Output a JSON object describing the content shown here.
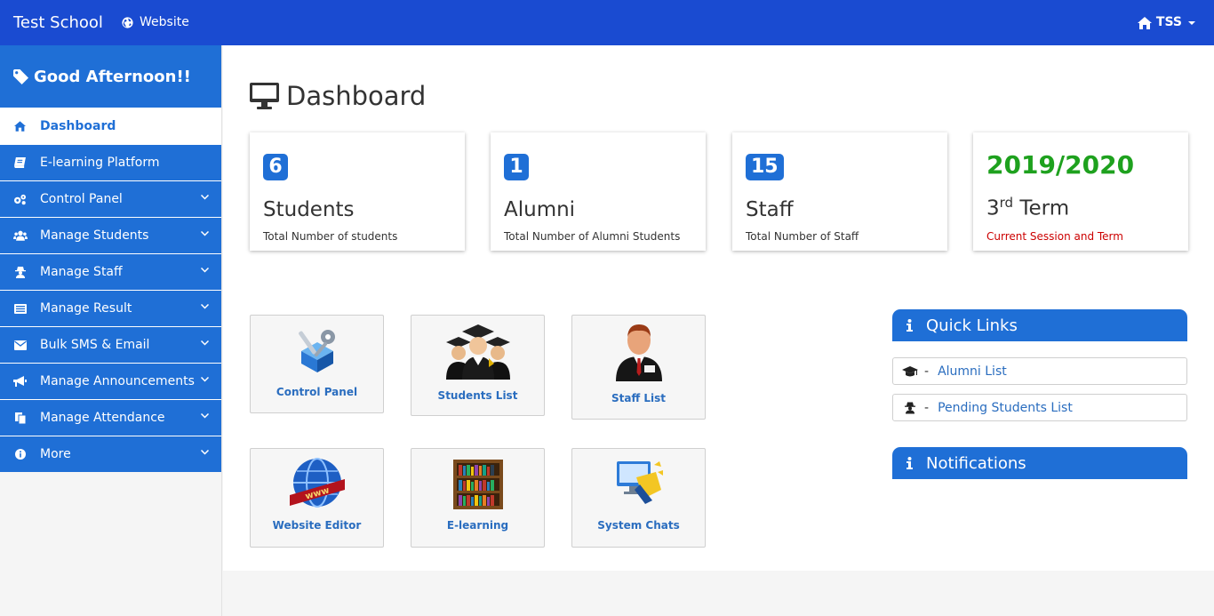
{
  "navbar": {
    "brand": "Test School",
    "website_label": "Website",
    "user_label": "TSS"
  },
  "sidebar": {
    "greeting": "Good Afternoon!!",
    "items": [
      {
        "label": "Dashboard",
        "icon": "home-icon",
        "active": true
      },
      {
        "label": "E-learning Platform",
        "icon": "book-icon"
      },
      {
        "label": "Control Panel",
        "icon": "cogs-icon"
      },
      {
        "label": "Manage Students",
        "icon": "users-icon"
      },
      {
        "label": "Manage Staff",
        "icon": "user-secret-icon"
      },
      {
        "label": "Manage Result",
        "icon": "list-icon"
      },
      {
        "label": "Bulk SMS & Email",
        "icon": "envelope-icon"
      },
      {
        "label": "Manage Announcements",
        "icon": "bullhorn-icon"
      },
      {
        "label": "Manage Attendance",
        "icon": "copy-icon"
      },
      {
        "label": "More",
        "icon": "info-icon"
      }
    ]
  },
  "main": {
    "title": "Dashboard",
    "stats": [
      {
        "count": "6",
        "name": "Students",
        "desc": "Total Number of students"
      },
      {
        "count": "1",
        "name": "Alumni",
        "desc": "Total Number of Alumni Students"
      },
      {
        "count": "15",
        "name": "Staff",
        "desc": "Total Number of Staff"
      }
    ],
    "session": {
      "year": "2019/2020",
      "term_number": "3",
      "term_suffix": "rd",
      "term_word": "Term",
      "desc": "Current Session and Term"
    },
    "tiles": [
      {
        "label": "Control Panel",
        "icon": "control-panel-icon"
      },
      {
        "label": "Students List",
        "icon": "graduates-icon"
      },
      {
        "label": "Staff List",
        "icon": "staff-person-icon"
      },
      {
        "label": "Website Editor",
        "icon": "www-globe-icon"
      },
      {
        "label": "E-learning",
        "icon": "bookshelf-icon"
      },
      {
        "label": "System Chats",
        "icon": "chat-computer-icon"
      }
    ]
  },
  "quick_links": {
    "title": "Quick Links",
    "items": [
      {
        "label": "Alumni List",
        "icon": "graduation-cap-icon"
      },
      {
        "label": "Pending Students List",
        "icon": "user-secret-icon"
      }
    ]
  },
  "notifications": {
    "title": "Notifications"
  },
  "colors": {
    "navbar": "#1a4bd1",
    "primary": "#1f6fd6",
    "session_green": "#1ea11e",
    "session_red": "#cc0000"
  }
}
